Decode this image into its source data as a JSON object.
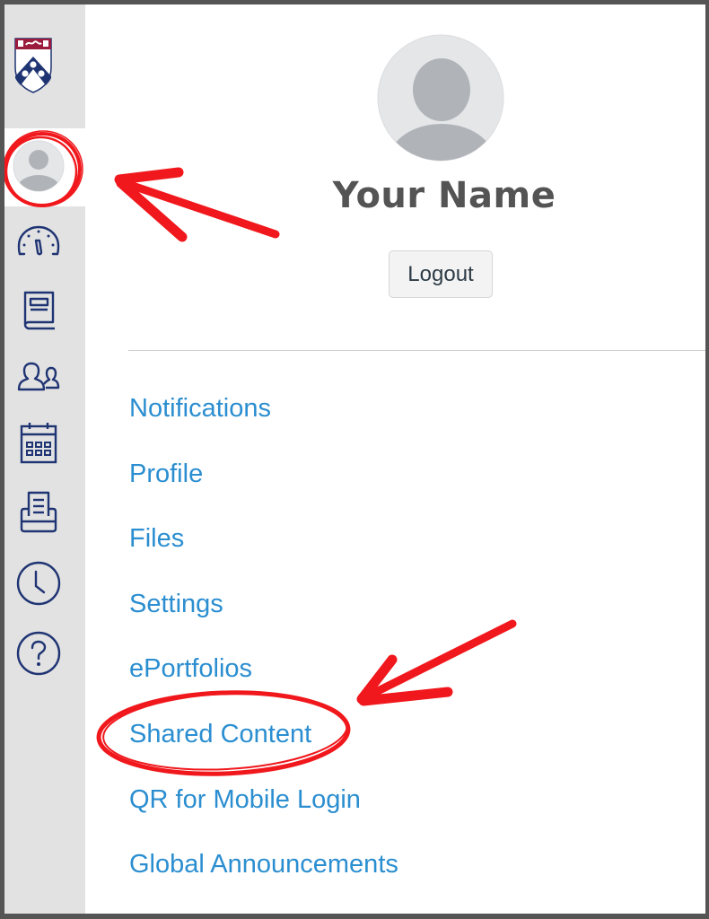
{
  "sidebar": {
    "logo": "university-shield-logo",
    "items": [
      {
        "name": "account",
        "icon": "user-avatar-icon",
        "active": true
      },
      {
        "name": "dashboard",
        "icon": "speedometer-icon",
        "active": false
      },
      {
        "name": "courses",
        "icon": "book-icon",
        "active": false
      },
      {
        "name": "groups",
        "icon": "users-icon",
        "active": false
      },
      {
        "name": "calendar",
        "icon": "calendar-icon",
        "active": false
      },
      {
        "name": "inbox",
        "icon": "inbox-tray-icon",
        "active": false
      },
      {
        "name": "history",
        "icon": "clock-icon",
        "active": false
      },
      {
        "name": "help",
        "icon": "help-question-icon",
        "active": false
      }
    ]
  },
  "account_tray": {
    "user_name": "Your Name",
    "logout_label": "Logout",
    "menu": [
      "Notifications",
      "Profile",
      "Files",
      "Settings",
      "ePortfolios",
      "Shared Content",
      "QR for Mobile Login",
      "Global Announcements"
    ]
  },
  "annotations": {
    "color": "#f0181c",
    "highlighted_items": [
      "sidebar account avatar",
      "Shared Content"
    ]
  },
  "colors": {
    "link": "#2b8ed0",
    "icon": "#1f3473",
    "sidebar_bg": "#e2e2e2"
  }
}
